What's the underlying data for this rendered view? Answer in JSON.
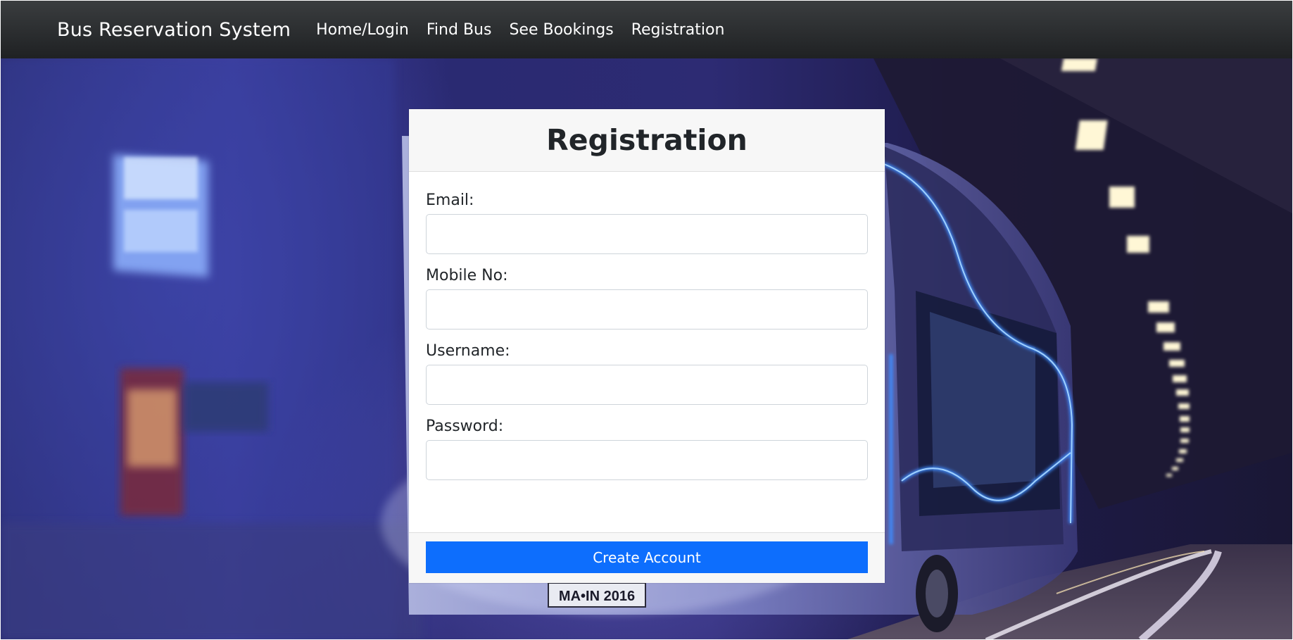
{
  "navbar": {
    "brand": "Bus Reservation System",
    "links": [
      "Home/Login",
      "Find Bus",
      "See Bookings",
      "Registration"
    ]
  },
  "form": {
    "title": "Registration",
    "fields": [
      {
        "label": "Email:",
        "value": ""
      },
      {
        "label": "Mobile No:",
        "value": ""
      },
      {
        "label": "Username:",
        "value": ""
      },
      {
        "label": "Password:",
        "value": ""
      }
    ],
    "submit_label": "Create Account"
  },
  "background": {
    "license_plate": "MA•IN 2016"
  },
  "colors": {
    "navbar": "#2c2e30",
    "primary_button": "#0d6efd",
    "card_header": "#f7f7f7"
  }
}
